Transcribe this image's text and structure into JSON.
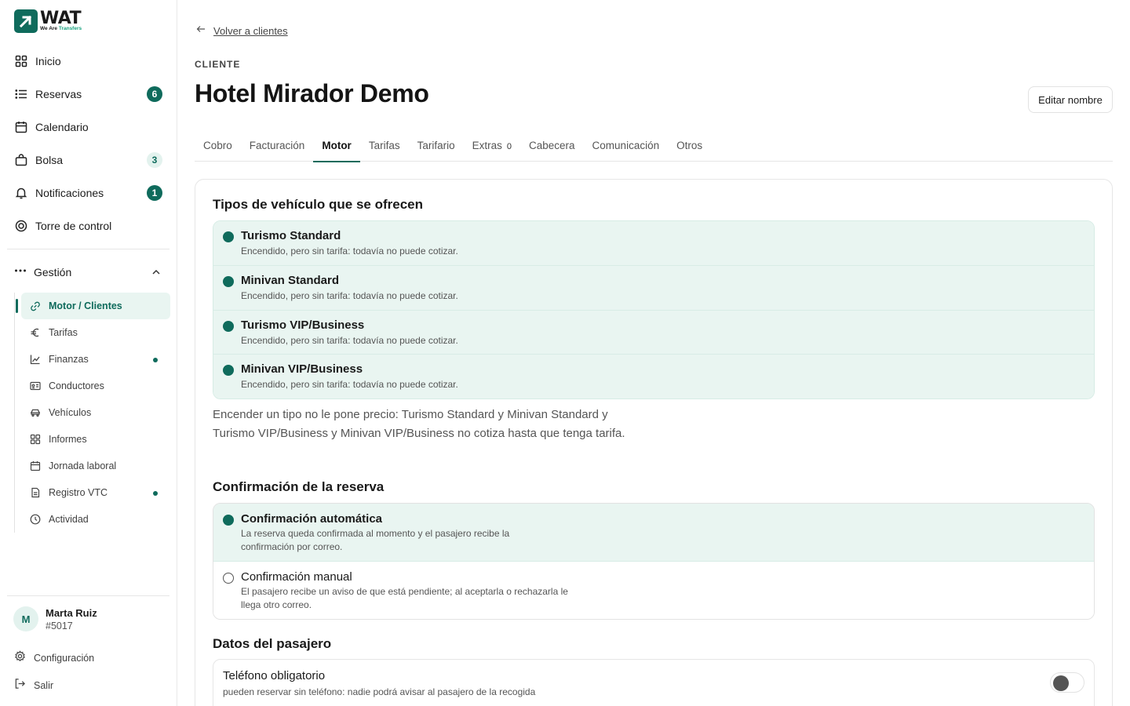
{
  "brand": {
    "name": "WAT",
    "tagline_prefix": "We Are ",
    "tagline_accent": "Transfers",
    "color": "#0f6b5c"
  },
  "sidebar": {
    "items": [
      {
        "label": "Inicio",
        "icon": "grid-icon"
      },
      {
        "label": "Reservas",
        "icon": "list-icon",
        "badge": "6"
      },
      {
        "label": "Calendario",
        "icon": "calendar-icon"
      },
      {
        "label": "Bolsa",
        "icon": "bag-icon",
        "badge": "3"
      },
      {
        "label": "Notificaciones",
        "icon": "bell-icon",
        "badge": "1"
      },
      {
        "label": "Torre de control",
        "icon": "target-icon"
      }
    ],
    "group": {
      "label": "Gestión",
      "icon": "more-icon"
    },
    "sub_items": [
      {
        "label": "Motor / Clientes",
        "icon": "link-icon",
        "active": true
      },
      {
        "label": "Tarifas",
        "icon": "euro-icon"
      },
      {
        "label": "Finanzas",
        "icon": "chart-icon",
        "dot": true
      },
      {
        "label": "Conductores",
        "icon": "id-card-icon"
      },
      {
        "label": "Vehículos",
        "icon": "car-icon"
      },
      {
        "label": "Informes",
        "icon": "grid-icon"
      },
      {
        "label": "Jornada laboral",
        "icon": "calendar-icon"
      },
      {
        "label": "Registro VTC",
        "icon": "document-icon",
        "dot": true
      },
      {
        "label": "Actividad",
        "icon": "clock-icon"
      }
    ],
    "user": {
      "initial": "M",
      "name": "Marta Ruiz",
      "id": "#5017"
    },
    "footer": {
      "settings": "Configuración",
      "logout": "Salir"
    }
  },
  "main": {
    "back_label": "Volver a clientes",
    "eyebrow": "CLIENTE",
    "title": "Hotel Mirador Demo",
    "edit_label": "Editar nombre",
    "tabs": [
      {
        "label": "Cobro"
      },
      {
        "label": "Facturación"
      },
      {
        "label": "Motor",
        "active": true
      },
      {
        "label": "Tarifas"
      },
      {
        "label": "Tarifario"
      },
      {
        "label": "Extras",
        "count": "0"
      },
      {
        "label": "Cabecera"
      },
      {
        "label": "Comunicación"
      },
      {
        "label": "Otros"
      }
    ],
    "vehicles": {
      "title": "Tipos de vehículo que se ofrecen",
      "options": [
        {
          "name": "Turismo Standard",
          "desc": "Encendido, pero sin tarifa: todavía no puede cotizar."
        },
        {
          "name": "Minivan Standard",
          "desc": "Encendido, pero sin tarifa: todavía no puede cotizar."
        },
        {
          "name": "Turismo VIP/Business",
          "desc": "Encendido, pero sin tarifa: todavía no puede cotizar."
        },
        {
          "name": "Minivan VIP/Business",
          "desc": "Encendido, pero sin tarifa: todavía no puede cotizar."
        }
      ],
      "note": "Encender un tipo no le pone precio: Turismo Standard y Minivan Standard y Turismo VIP/Business y Minivan VIP/Business no cotiza hasta que tenga tarifa."
    },
    "confirmation": {
      "title": "Confirmación de la reserva",
      "options": [
        {
          "name": "Confirmación automática",
          "desc": "La reserva queda confirmada al momento y el pasajero recibe la confirmación por correo.",
          "selected": true
        },
        {
          "name": "Confirmación manual",
          "desc": "El pasajero recibe un aviso de que está pendiente; al aceptarla o rechazarla le llega otro correo.",
          "selected": false
        }
      ]
    },
    "passenger": {
      "title": "Datos del pasajero",
      "phone": {
        "title": "Teléfono obligatorio",
        "desc": "pueden reservar sin teléfono: nadie podrá avisar al pasajero de la recogida",
        "enabled": false
      }
    }
  }
}
